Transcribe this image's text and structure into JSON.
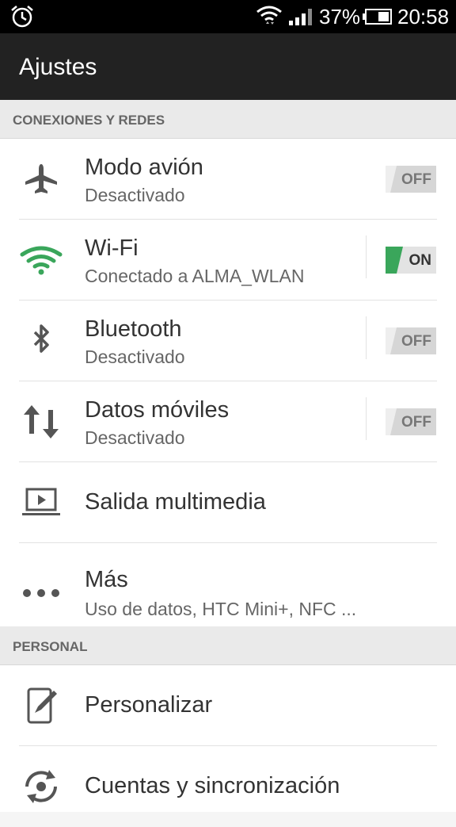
{
  "status_bar": {
    "battery_percent": "37%",
    "time": "20:58"
  },
  "app_bar": {
    "title": "Ajustes"
  },
  "sections": [
    {
      "header": "CONEXIONES Y REDES",
      "items": [
        {
          "title": "Modo avión",
          "subtitle": "Desactivado",
          "icon": "airplane-icon",
          "toggle": "OFF"
        },
        {
          "title": "Wi-Fi",
          "subtitle": "Conectado a ALMA_WLAN",
          "icon": "wifi-icon",
          "toggle": "ON"
        },
        {
          "title": "Bluetooth",
          "subtitle": "Desactivado",
          "icon": "bluetooth-icon",
          "toggle": "OFF"
        },
        {
          "title": "Datos móviles",
          "subtitle": "Desactivado",
          "icon": "data-transfer-icon",
          "toggle": "OFF"
        },
        {
          "title": "Salida multimedia",
          "icon": "media-output-icon"
        },
        {
          "title": "Más",
          "subtitle": "Uso de datos, HTC Mini+, NFC ...",
          "icon": "more-dots-icon"
        }
      ]
    },
    {
      "header": "PERSONAL",
      "items": [
        {
          "title": "Personalizar",
          "icon": "personalize-icon"
        },
        {
          "title": "Cuentas y sincronización",
          "icon": "sync-icon"
        }
      ]
    }
  ],
  "colors": {
    "accent_green": "#3aa65b",
    "toggle_off": "#d6d6d6"
  }
}
